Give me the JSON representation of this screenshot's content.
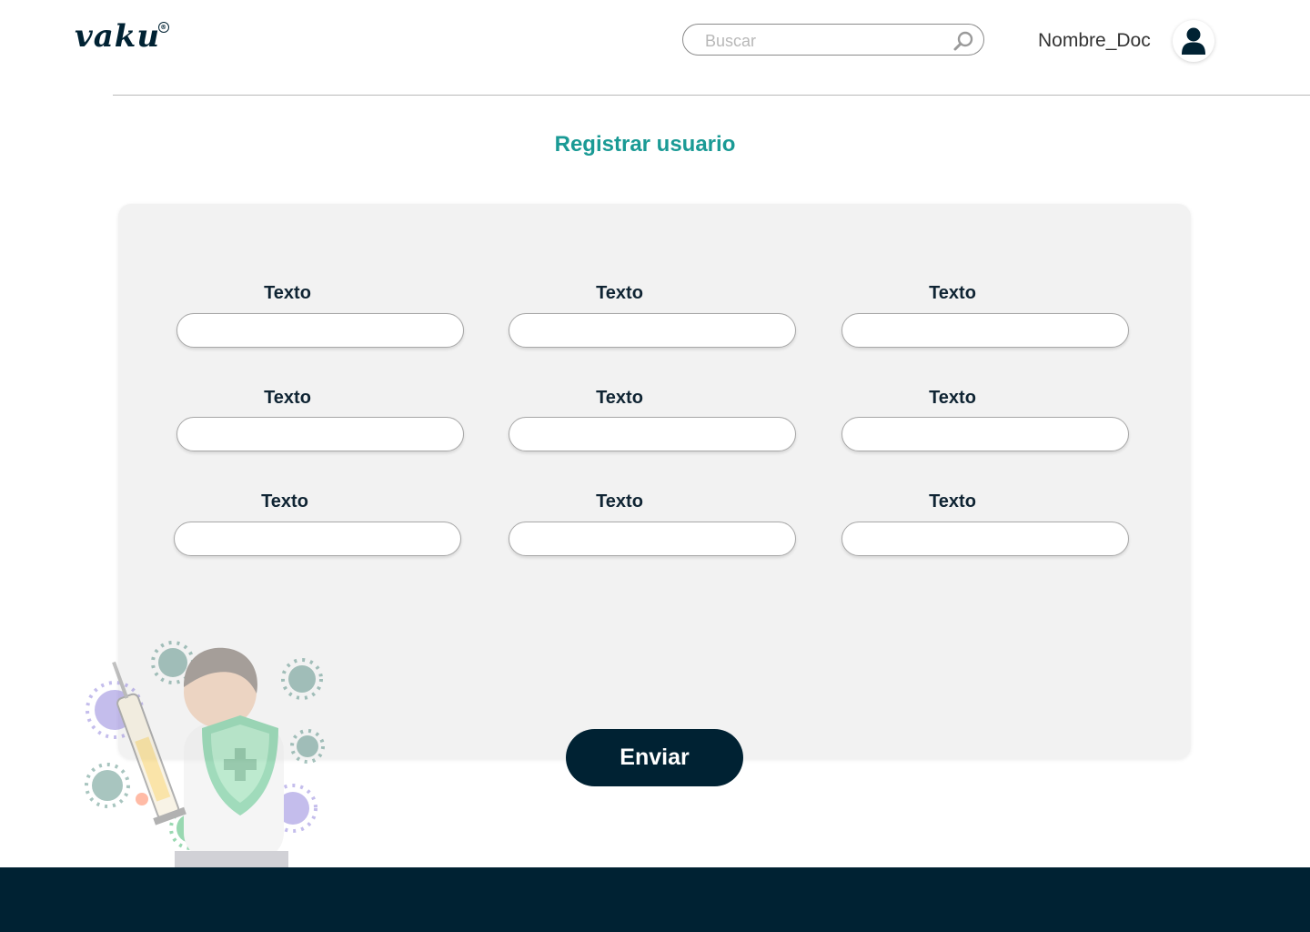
{
  "header": {
    "logo_text": "vaku",
    "logo_mark": "®",
    "search": {
      "placeholder": "Buscar",
      "icon": "search-icon"
    },
    "user": {
      "name": "Nombre_Doc",
      "icon": "user-icon"
    }
  },
  "page": {
    "title": "Registrar usuario"
  },
  "form": {
    "fields": [
      {
        "label": "Texto",
        "value": ""
      },
      {
        "label": "Texto",
        "value": ""
      },
      {
        "label": "Texto",
        "value": ""
      },
      {
        "label": "Texto",
        "value": ""
      },
      {
        "label": "Texto",
        "value": ""
      },
      {
        "label": "Texto",
        "value": ""
      },
      {
        "label": "Texto",
        "value": ""
      },
      {
        "label": "Texto",
        "value": ""
      },
      {
        "label": "Texto",
        "value": ""
      }
    ],
    "submit_label": "Enviar"
  },
  "colors": {
    "brand_dark": "#002233",
    "accent_teal": "#1a9a95",
    "card_bg": "#f2f2f2"
  }
}
